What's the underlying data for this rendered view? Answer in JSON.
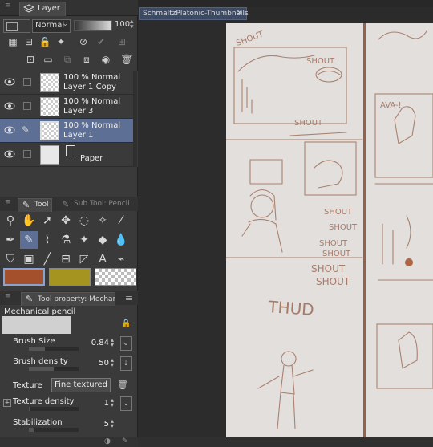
{
  "layer_panel": {
    "tab_label": "Layer",
    "blend_mode": "Normal",
    "opacity": "100",
    "layers": [
      {
        "line1": "100 % Normal",
        "line2": "Layer 1 Copy",
        "active": false
      },
      {
        "line1": "100 % Normal",
        "line2": "Layer 3",
        "active": false
      },
      {
        "line1": "100 % Normal",
        "line2": "Layer 1",
        "active": true
      }
    ],
    "paper_label": "Paper"
  },
  "tool_panel": {
    "tab_tool": "Tool",
    "tab_subtool": "Sub Tool: Pencil",
    "colors": {
      "main": "#a5502d",
      "sub": "#a59420"
    }
  },
  "tool_property": {
    "tab_label": "Tool property: Mechanical pencil",
    "name": "Mechanical pencil",
    "brush_size_label": "Brush Size",
    "brush_size_value": "0.84",
    "brush_density_label": "Brush density",
    "brush_density_value": "50",
    "texture_label": "Texture",
    "texture_value": "Fine textured",
    "texture_density_label": "Texture density",
    "texture_density_value": "1",
    "stabilization_label": "Stabilization",
    "stabilization_value": "5"
  },
  "document": {
    "tab_title": "SchmaltzPlatonic-Thumbnails"
  },
  "sketch_text": {
    "shout": "SHOUT",
    "thud": "THUD",
    "ava": "AVA-!"
  }
}
